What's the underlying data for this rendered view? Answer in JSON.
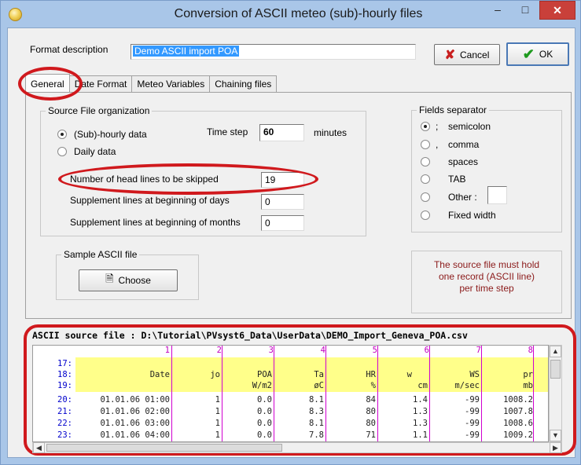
{
  "window": {
    "title": "Conversion of ASCII meteo  (sub)-hourly files",
    "minimize": "–",
    "maximize": "□",
    "close": "✕"
  },
  "format": {
    "label": "Format description",
    "value": "Demo ASCII import POA"
  },
  "buttons": {
    "cancel": "Cancel",
    "ok": "OK",
    "choose": "Choose"
  },
  "tabs": [
    "General",
    "Date Format",
    "Meteo Variables",
    "Chaining files"
  ],
  "source": {
    "group_title": "Source File organization",
    "hourly_label": "(Sub)-hourly data",
    "hourly_selected": true,
    "daily_label": "Daily data",
    "timestep_label": "Time step",
    "timestep_value": "60",
    "timestep_unit": "minutes",
    "head_lines_label": "Number of head lines to be skipped",
    "head_lines_value": "19",
    "supp_days_label": "Supplement lines at beginning of days",
    "supp_days_value": "0",
    "supp_months_label": "Supplement lines at beginning of months",
    "supp_months_value": "0"
  },
  "sample": {
    "group_title": "Sample ASCII  file"
  },
  "separator": {
    "group_title": "Fields separator",
    "options": [
      {
        "key": ";",
        "label": "semicolon",
        "selected": true
      },
      {
        "key": ",",
        "label": "comma",
        "selected": false
      },
      {
        "key": "",
        "label": "spaces",
        "selected": false
      },
      {
        "key": "",
        "label": "TAB",
        "selected": false
      },
      {
        "key": "",
        "label": "Other :",
        "selected": false
      },
      {
        "key": "",
        "label": "Fixed width",
        "selected": false
      }
    ]
  },
  "note": {
    "lines": [
      "The source file must hold",
      "one record (ASCII line)",
      "per time step"
    ]
  },
  "file": {
    "header": "ASCII source file : D:\\Tutorial\\PVsyst6_Data\\UserData\\DEMO_Import_Geneva_POA.csv",
    "column_numbers": [
      "1",
      "2",
      "3",
      "4",
      "5",
      "6",
      "7",
      "8"
    ],
    "header_rows": [
      {
        "num": "17:",
        "cells": [
          "",
          "",
          "",
          "",
          "",
          "",
          "",
          ""
        ]
      },
      {
        "num": "18:",
        "cells": [
          "Date",
          "jo",
          "POA",
          "Ta",
          "HR",
          "w",
          "WS",
          "pr"
        ]
      },
      {
        "num": "19:",
        "cells": [
          "",
          "",
          "W/m2",
          "øC",
          "%",
          "cm",
          "m/sec",
          "mb"
        ]
      }
    ],
    "data_rows": [
      {
        "num": "20:",
        "cells": [
          "01.01.06 01:00",
          "1",
          "0.0",
          "8.1",
          "84",
          "1.4",
          "-99",
          "1008.2"
        ]
      },
      {
        "num": "21:",
        "cells": [
          "01.01.06 02:00",
          "1",
          "0.0",
          "8.3",
          "80",
          "1.3",
          "-99",
          "1007.8"
        ]
      },
      {
        "num": "22:",
        "cells": [
          "01.01.06 03:00",
          "1",
          "0.0",
          "8.1",
          "80",
          "1.3",
          "-99",
          "1008.6"
        ]
      },
      {
        "num": "23:",
        "cells": [
          "01.01.06 04:00",
          "1",
          "0.0",
          "7.8",
          "71",
          "1.1",
          "-99",
          "1009.2"
        ]
      }
    ]
  }
}
